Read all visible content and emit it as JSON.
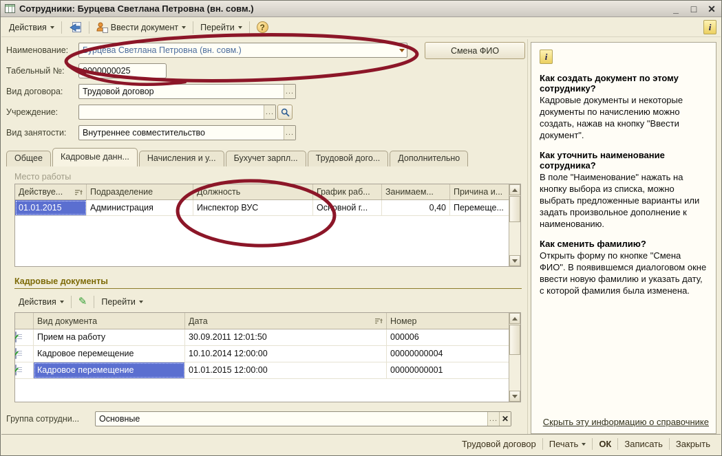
{
  "colors": {
    "selection_blue": "#5b6fd0",
    "annotation_red": "#8c1628",
    "section_heading": "#7d6a08",
    "field_value_blue": "#4d6e9e"
  },
  "window": {
    "title": "Сотрудники: Бурцева Светлана Петровна (вн. совм.)",
    "minimize": "_",
    "maximize": "□",
    "close": "✕"
  },
  "toolbar": {
    "actions": "Действия",
    "enter_document": "Ввести документ",
    "goto": "Перейти",
    "help": "?",
    "info": "i"
  },
  "form": {
    "name_label": "Наименование:",
    "name_value": "Бурцева Светлана Петровна (вн. совм.)",
    "change_name_button": "Смена ФИО",
    "number_label": "Табельный №:",
    "number_value": "0000000025",
    "contract_label": "Вид договора:",
    "contract_value": "Трудовой договор",
    "institution_label": "Учреждение:",
    "institution_value": "",
    "employment_label": "Вид занятости:",
    "employment_value": "Внутреннее совместительство",
    "ellipsis": "...",
    "clear": "✕"
  },
  "tabs": [
    "Общее",
    "Кадровые данн...",
    "Начисления и у...",
    "Бухучет зарпл...",
    "Трудовой дого...",
    "Дополнительно"
  ],
  "workplace": {
    "title": "Место работы",
    "columns": [
      "Действуе...",
      "Подразделение",
      "Должность",
      "График раб...",
      "Занимаем...",
      "Причина и..."
    ],
    "row": [
      "01.01.2015",
      "Администрация",
      "Инспектор ВУС",
      "Основной г...",
      "0,40",
      "Перемеще..."
    ]
  },
  "documents": {
    "title": "Кадровые документы",
    "actions": "Действия",
    "goto": "Перейти",
    "columns": [
      "Вид документа",
      "Дата",
      "Номер"
    ],
    "rows": [
      [
        "Прием на работу",
        "30.09.2011 12:01:50",
        "000006"
      ],
      [
        "Кадровое перемещение",
        "10.10.2014 12:00:00",
        "00000000004"
      ],
      [
        "Кадровое перемещение",
        "01.01.2015 12:00:00",
        "00000000001"
      ]
    ]
  },
  "group": {
    "label": "Группа сотрудни...",
    "value": "Основные"
  },
  "help": {
    "q1": "Как создать документ по этому сотруднику?",
    "a1": "Кадровые документы и некоторые документы по начислению можно создать, нажав на кнопку \"Ввести документ\".",
    "q2": "Как уточнить наименование сотрудника?",
    "a2": "В поле \"Наименование\" нажать на кнопку выбора из списка, можно выбрать предложенные варианты или задать произвольное дополнение к наименованию.",
    "q3": "Как сменить фамилию?",
    "a3": "Открыть форму по кнопке \"Смена ФИО\". В появившемся диалоговом окне ввести новую фамилию и указать дату, с которой фамилия была изменена.",
    "hide_link": "Скрыть эту информацию о справочнике"
  },
  "bottom": {
    "labor_contract": "Трудовой договор",
    "print": "Печать",
    "ok": "ОК",
    "save": "Записать",
    "close": "Закрыть"
  }
}
